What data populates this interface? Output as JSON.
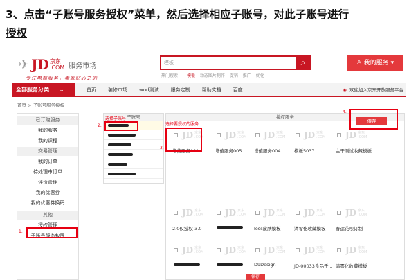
{
  "title": {
    "line1": "3、点击“子账号服务授权”菜单，然后选择相应子账号，对此子账号进行",
    "line2": "授权"
  },
  "header": {
    "logo_jd": "JD",
    "logo_cn": "京东",
    "logo_com": ".COM",
    "market_label": "服务市场",
    "slogan": "专注电商服务，卖家贴心之选",
    "search_placeholder": "模板",
    "hot_links": [
      "热门搜索：",
      "模板",
      "动态图片制作",
      "促销",
      "推广",
      "优化"
    ],
    "my_service_label": "我的服务 ▾"
  },
  "nav": {
    "category_label": "全部服务分类",
    "items": [
      "首页",
      "装修市场",
      "wnd测试",
      "服务定制",
      "帮助文档",
      "百度"
    ],
    "notice": "欢迎加入京东开放服务平台"
  },
  "breadcrumb": "首页  >  子账号服务授权",
  "sidebar": {
    "items": [
      {
        "label": "已订购服务",
        "head": true
      },
      {
        "label": "我的服务",
        "head": false
      },
      {
        "label": "我的课程",
        "head": false
      },
      {
        "label": "交易管理",
        "head": true
      },
      {
        "label": "我的订单",
        "head": false
      },
      {
        "label": "待处理审订单",
        "head": false
      },
      {
        "label": "评价管理",
        "head": false
      },
      {
        "label": "我的优惠券",
        "head": false
      },
      {
        "label": "我的优惠券换码",
        "head": false
      },
      {
        "label": "其他",
        "head": true
      },
      {
        "label": "授权管理",
        "head": false
      },
      {
        "label": "子账号服务权限",
        "head": false
      }
    ]
  },
  "subaccounts": {
    "header": "子账号"
  },
  "services": {
    "header": "授权服务",
    "row1": [
      "增值服务001",
      "增值服务005",
      "增值服务004",
      "模板5037",
      "主干测试收藏模板"
    ],
    "row2": [
      "2.0仅授权-3.0",
      "",
      "less皮肤模板",
      "清零化收藏模板",
      "春运花呗订制"
    ],
    "row3": [
      "",
      "",
      "D9Design",
      "JD-00033食品千...",
      "清零化收藏模板"
    ],
    "logo_text": "JD",
    "logo_cn": "京东",
    "logo_com": ".COM"
  },
  "buttons": {
    "save_top": "保存",
    "save_bottom": "保存"
  },
  "annotations": {
    "num1": "1.",
    "num2": "2.",
    "num3": "3.",
    "num4": "4.",
    "select_subaccount": "选择子账号",
    "select_services": "选择要授权的服务"
  },
  "colors": {
    "brand_red": "#c81623",
    "button_red": "#e4393c",
    "annotation_red": "#e60012"
  },
  "icons": {
    "search": "search-icon",
    "user": "user-icon",
    "chevron": "chevron-down-icon",
    "notice": "speaker-icon"
  }
}
